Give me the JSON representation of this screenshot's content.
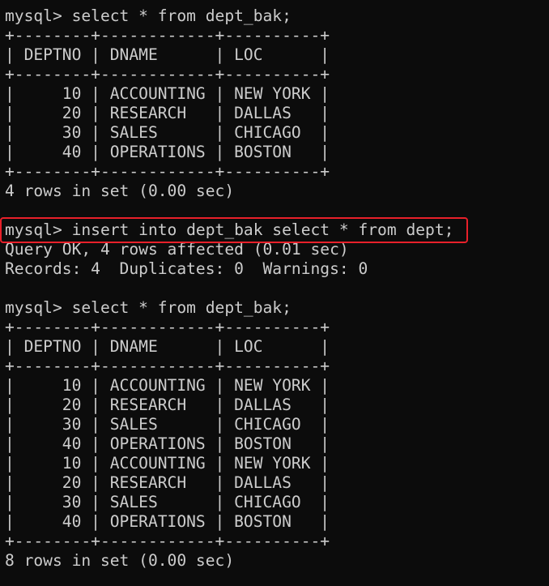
{
  "terminal": {
    "lines": [
      "mysql> select * from dept_bak;",
      "+--------+------------+----------+",
      "| DEPTNO | DNAME      | LOC      |",
      "+--------+------------+----------+",
      "|     10 | ACCOUNTING | NEW YORK |",
      "|     20 | RESEARCH   | DALLAS   |",
      "|     30 | SALES      | CHICAGO  |",
      "|     40 | OPERATIONS | BOSTON   |",
      "+--------+------------+----------+",
      "4 rows in set (0.00 sec)",
      "",
      "mysql> insert into dept_bak select * from dept;",
      "Query OK, 4 rows affected (0.01 sec)",
      "Records: 4  Duplicates: 0  Warnings: 0",
      "",
      "mysql> select * from dept_bak;",
      "+--------+------------+----------+",
      "| DEPTNO | DNAME      | LOC      |",
      "+--------+------------+----------+",
      "|     10 | ACCOUNTING | NEW YORK |",
      "|     20 | RESEARCH   | DALLAS   |",
      "|     30 | SALES      | CHICAGO  |",
      "|     40 | OPERATIONS | BOSTON   |",
      "|     10 | ACCOUNTING | NEW YORK |",
      "|     20 | RESEARCH   | DALLAS   |",
      "|     30 | SALES      | CHICAGO  |",
      "|     40 | OPERATIONS | BOSTON   |",
      "+--------+------------+----------+",
      "8 rows in set (0.00 sec)"
    ]
  },
  "colors": {
    "background": "#0c0c0c",
    "text": "#cccccc",
    "highlight_border": "#e8202a"
  }
}
